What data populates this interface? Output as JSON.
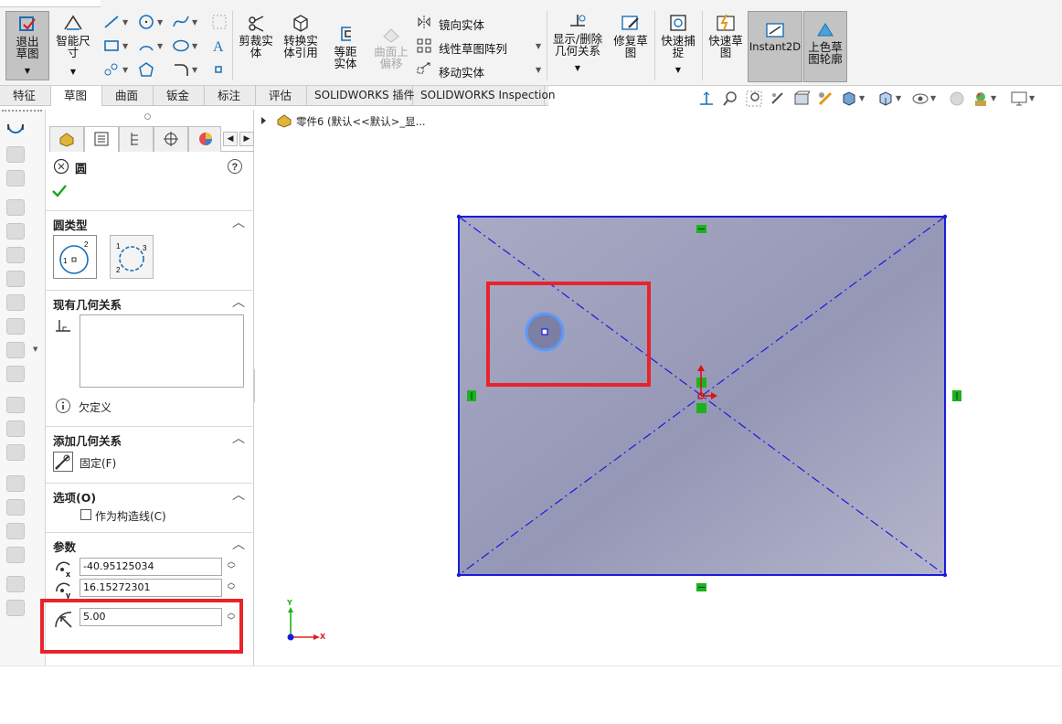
{
  "ribbon": {
    "exit_sketch": "退出草图",
    "smart_dimension": "智能尺寸",
    "trim_entities": "剪裁实体",
    "convert_entities": "转换实体引用",
    "offset_entities": "等距实体",
    "offset_on_surface": "曲面上偏移",
    "mirror_entities": "镜向实体",
    "linear_pattern": "线性草图阵列",
    "move_entities": "移动实体",
    "display_delete_relations": "显示/删除几何关系",
    "repair_sketch": "修复草图",
    "quick_snaps": "快速捕捉",
    "rapid_sketch": "快速草图",
    "instant2d": "Instant2D",
    "shaded_contours": "上色草图轮廓"
  },
  "tabs": [
    "特征",
    "草图",
    "曲面",
    "钣金",
    "标注",
    "评估",
    "SOLIDWORKS 插件",
    "SOLIDWORKS Inspection"
  ],
  "tree": {
    "breadcrumb": "零件6 (默认<<默认>_显..."
  },
  "pm": {
    "title": "圆",
    "circle_type_header": "圆类型",
    "existing_relations_header": "现有几何关系",
    "status_text": "欠定义",
    "add_relations_header": "添加几何关系",
    "fix_label": "固定(F)",
    "options_header": "选项(O)",
    "construction_label": "作为构造线(C)",
    "construction_checked": false,
    "params_header": "参数",
    "cx_value": "-40.95125034",
    "cy_value": "16.15272301",
    "radius_value": "5.00"
  },
  "triad": {
    "x_label": "X",
    "y_label": "Y"
  },
  "colors": {
    "sketch_blue": "#1a1adf",
    "highlight_red": "#e8232a",
    "relation_green": "#1bb31b",
    "face_gray": "#a6a8c0"
  }
}
